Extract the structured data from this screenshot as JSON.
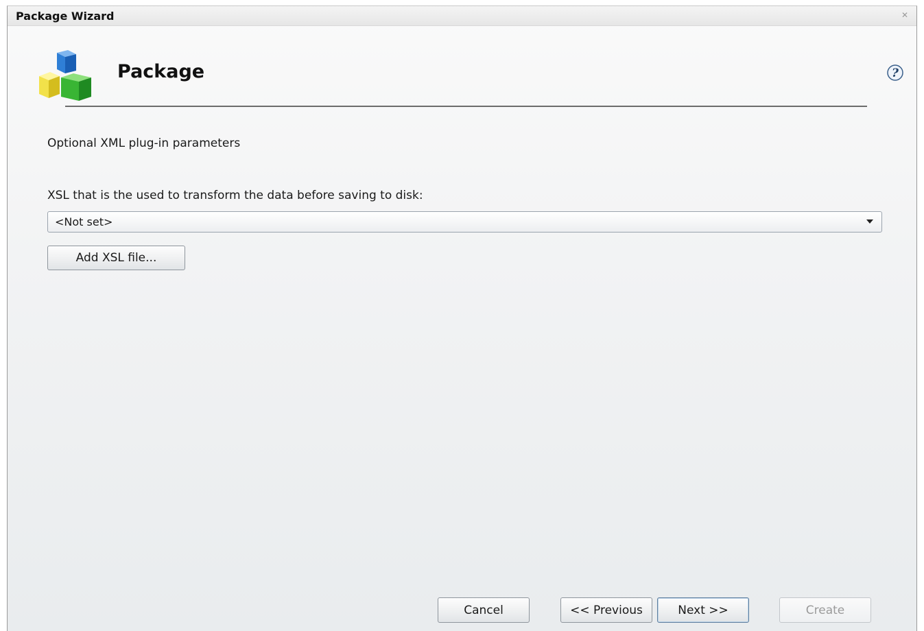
{
  "window": {
    "title": "Package Wizard",
    "close_icon": "close-icon"
  },
  "header": {
    "title": "Package",
    "icon": "package-cubes-icon",
    "help_icon": "help-icon"
  },
  "main": {
    "section_label": "Optional XML plug-in parameters",
    "xsl_field_label": "XSL that is the used to transform the data before saving to disk:",
    "xsl_select_value": "<Not set>",
    "add_xsl_button": "Add XSL file..."
  },
  "footer": {
    "cancel_label": "Cancel",
    "previous_label": "<< Previous",
    "next_label": "Next >>",
    "create_label": "Create",
    "create_enabled": false
  }
}
